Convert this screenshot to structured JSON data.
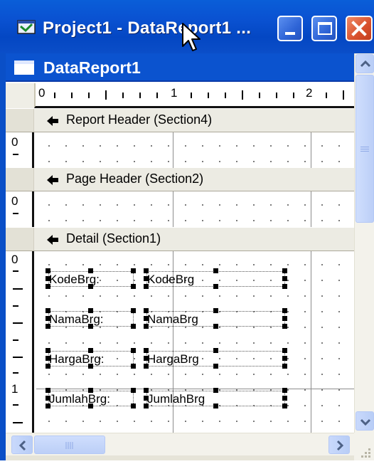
{
  "window": {
    "title": "Project1 - DataReport1 ...",
    "icon": "vb-project-icon"
  },
  "document": {
    "title": "DataReport1",
    "icon": "report-document-icon"
  },
  "ruler": {
    "labels": [
      "0",
      "1",
      "2"
    ]
  },
  "sections": [
    {
      "label": "Report Header (Section4)",
      "ruler_start": "0"
    },
    {
      "label": "Page Header (Section2)",
      "ruler_start": "0"
    },
    {
      "label": "Detail (Section1)",
      "ruler_start": "0",
      "ruler_mark": "1"
    }
  ],
  "detail_fields": [
    {
      "label": "KodeBrg:",
      "field": "KodeBrg"
    },
    {
      "label": "NamaBrg:",
      "field": "NamaBrg"
    },
    {
      "label": "HargaBrg:",
      "field": "HargaBrg"
    },
    {
      "label": "JumlahBrg:",
      "field": "JumlahBrg"
    }
  ],
  "colors": {
    "titlebar": "#0a52d2",
    "section_bar": "#ecebe3",
    "close_button": "#d8502d"
  }
}
